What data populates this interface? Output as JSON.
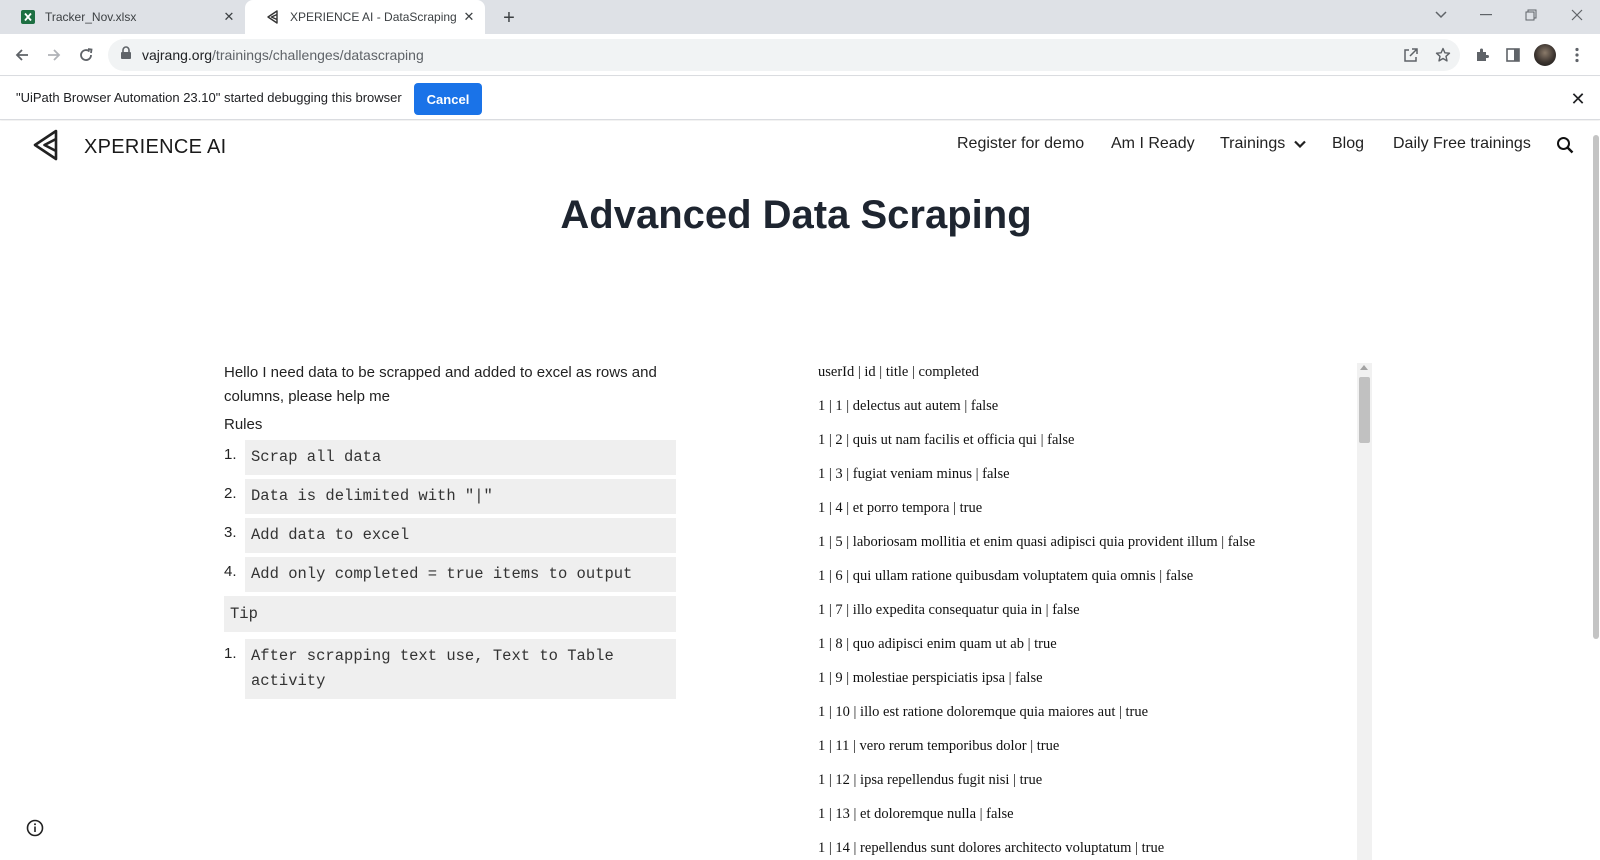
{
  "tabs": [
    {
      "title": "Tracker_Nov.xlsx",
      "icon": "excel-icon"
    },
    {
      "title": "XPERIENCE AI - DataScraping",
      "icon": "xperience-logo-icon"
    }
  ],
  "address_bar": {
    "domain": "vajrang.org",
    "path": "/trainings/challenges/datascraping"
  },
  "infobar": {
    "message": "\"UiPath Browser Automation 23.10\" started debugging this browser",
    "cancel_label": "Cancel"
  },
  "site": {
    "brand": "XPERIENCE AI",
    "nav": [
      "Register for demo",
      "Am I Ready",
      "Trainings",
      "Blog",
      "Daily Free trainings"
    ]
  },
  "main": {
    "title": "Advanced Data Scraping",
    "intro": "Hello I need data to be scrapped and added to excel as rows and columns, please help me",
    "rules_label": "Rules",
    "rules": [
      {
        "num": "1.",
        "text": "Scrap all data"
      },
      {
        "num": "2.",
        "text": "Data is delimited with \"|\""
      },
      {
        "num": "3.",
        "text": "Add data to excel"
      },
      {
        "num": "4.",
        "text": "Add only completed = true items to output"
      }
    ],
    "tip_label": "Tip",
    "tips": [
      {
        "num": "1.",
        "text": "After scrapping text use, Text to Table activity"
      }
    ]
  },
  "data_lines": [
    "userId | id | title | completed",
    "1 | 1 | delectus aut autem | false",
    "1 | 2 | quis ut nam facilis et officia qui | false",
    "1 | 3 | fugiat veniam minus | false",
    "1 | 4 | et porro tempora | true",
    "1 | 5 | laboriosam mollitia et enim quasi adipisci quia provident illum | false",
    "1 | 6 | qui ullam ratione quibusdam voluptatem quia omnis | false",
    "1 | 7 | illo expedita consequatur quia in | false",
    "1 | 8 | quo adipisci enim quam ut ab | true",
    "1 | 9 | molestiae perspiciatis ipsa | false",
    "1 | 10 | illo est ratione doloremque quia maiores aut | true",
    "1 | 11 | vero rerum temporibus dolor | true",
    "1 | 12 | ipsa repellendus fugit nisi | true",
    "1 | 13 | et doloremque nulla | false",
    "1 | 14 | repellendus sunt dolores architecto voluptatum | true"
  ],
  "colors": {
    "accent": "#1a73e8",
    "code_bg": "#efefef",
    "title": "#1e2530"
  }
}
